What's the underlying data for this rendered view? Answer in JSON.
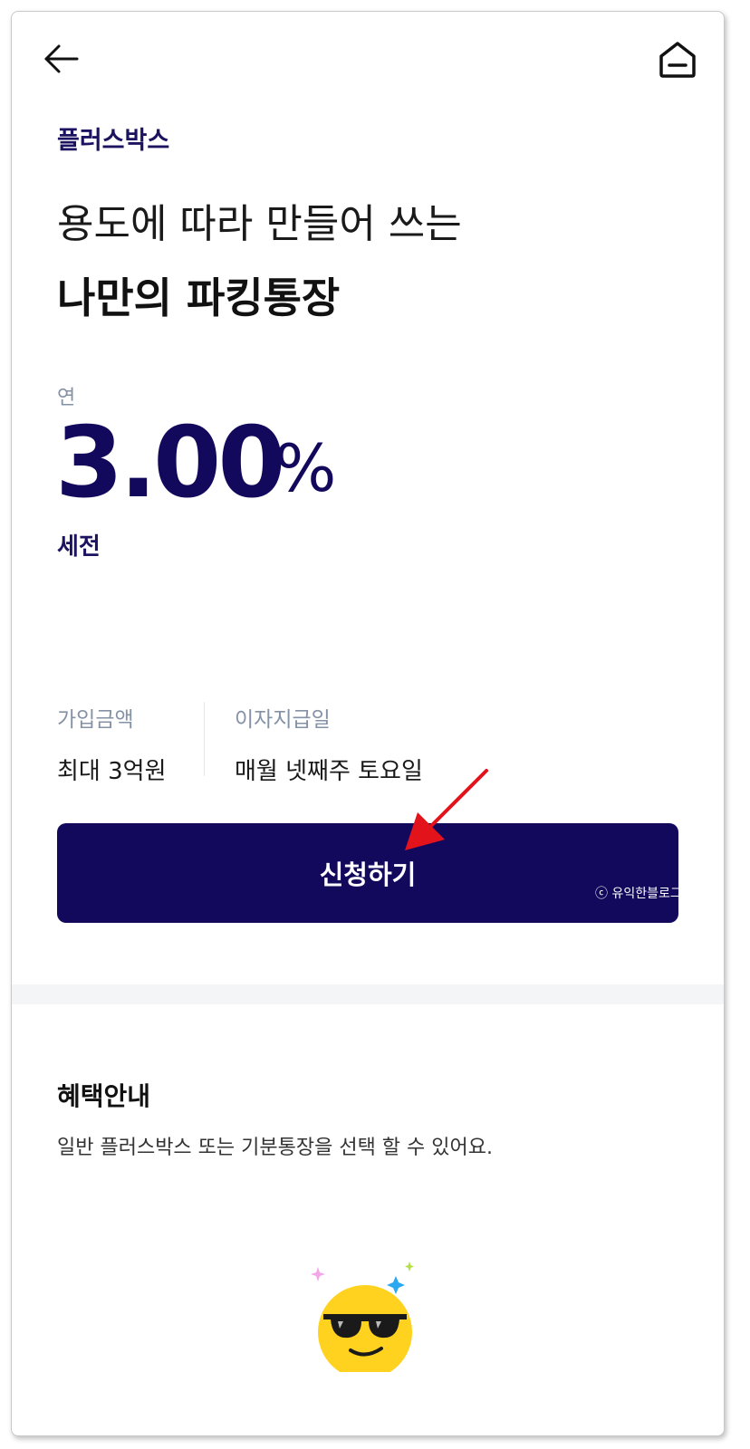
{
  "header": {
    "back_icon": "arrow-left-icon",
    "home_icon": "home-icon"
  },
  "product": {
    "name": "플러스박스",
    "headline_line1": "용도에 따라 만들어 쓰는",
    "headline_line2": "나만의 파킹통장"
  },
  "rate": {
    "prefix": "연",
    "value": "3.00",
    "unit": "%",
    "suffix": "세전"
  },
  "info": {
    "deposit_label": "가입금액",
    "deposit_value": "최대 3억원",
    "interest_label": "이자지급일",
    "interest_value": "매월 넷째주 토요일"
  },
  "apply_button": {
    "label": "신청하기"
  },
  "watermark": "ⓒ 유익한블로그",
  "benefits": {
    "title": "혜택안내",
    "description": "일반 플러스박스 또는 기분통장을 선택 할 수 있어요."
  },
  "colors": {
    "brand_navy": "#12095c",
    "label_gray": "#8592a6",
    "annotation_red": "#e3131b",
    "emoji_yellow": "#ffd21f"
  },
  "decorations": {
    "annotation": "red-arrow-icon",
    "illustration": "sunglasses-emoji-icon"
  }
}
